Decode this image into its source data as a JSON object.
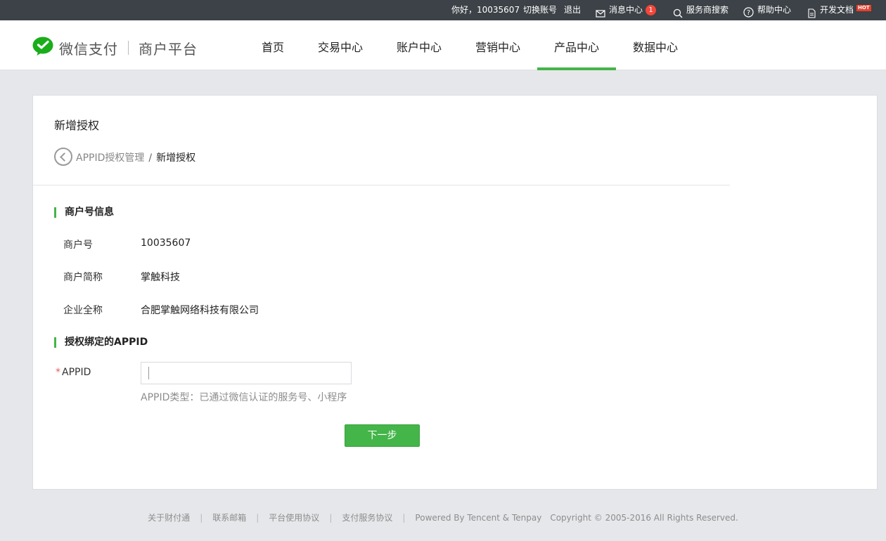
{
  "topbar": {
    "greeting": "你好，10035607",
    "switch_account": "切换账号",
    "logout": "退出",
    "messages": "消息中心",
    "message_count": "1",
    "provider_search": "服务商搜索",
    "help": "帮助中心",
    "dev_docs": "开发文档",
    "hot_tag": "HOT"
  },
  "header": {
    "brand": "微信支付",
    "subtitle": "商户平台",
    "nav": [
      {
        "label": "首页",
        "active": false
      },
      {
        "label": "交易中心",
        "active": false
      },
      {
        "label": "账户中心",
        "active": false
      },
      {
        "label": "营销中心",
        "active": false
      },
      {
        "label": "产品中心",
        "active": true
      },
      {
        "label": "数据中心",
        "active": false
      }
    ]
  },
  "page": {
    "title": "新增授权",
    "breadcrumb": {
      "parent": "APPID授权管理",
      "separator": "/",
      "current": "新增授权"
    }
  },
  "merchant_section": {
    "title": "商户号信息",
    "rows": [
      {
        "label": "商户号",
        "value": "10035607"
      },
      {
        "label": "商户简称",
        "value": "掌触科技"
      },
      {
        "label": "企业全称",
        "value": "合肥掌触网络科技有限公司"
      }
    ]
  },
  "appid_section": {
    "title": "授权绑定的APPID",
    "required_mark": "*",
    "field_label": "APPID",
    "field_value": "",
    "hint": "APPID类型：已通过微信认证的服务号、小程序",
    "next_button": "下一步"
  },
  "footer": {
    "links": [
      "关于财付通",
      "联系邮箱",
      "平台使用协议",
      "支付服务协议"
    ],
    "powered": "Powered By Tencent & Tenpay",
    "copyright": "Copyright © 2005-2016 All Rights Reserved."
  },
  "colors": {
    "accent": "#44b549",
    "topbar": "#3c4247",
    "badge": "#f5463a"
  }
}
